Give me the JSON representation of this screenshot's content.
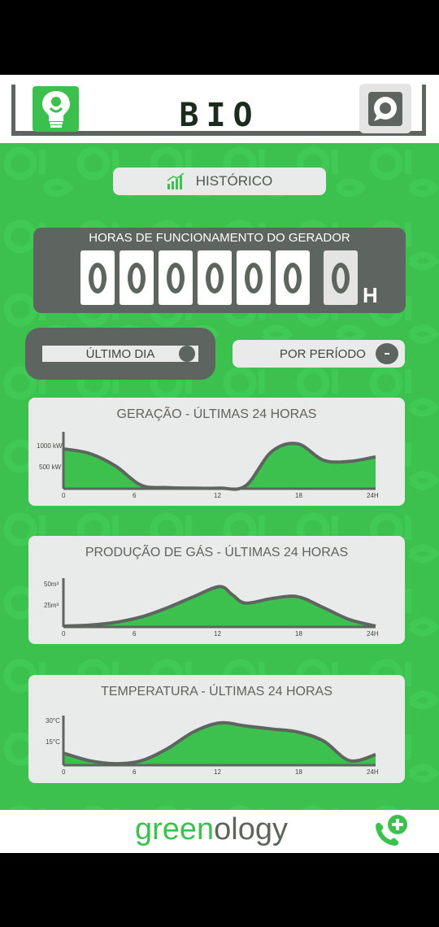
{
  "header": {
    "title": "BIO",
    "logo_icon": "lightbulb-icon",
    "chat_icon": "chat-bubble-icon"
  },
  "history_button": {
    "label": "HISTÓRICO",
    "icon": "bar-chart-growth-icon"
  },
  "counter": {
    "title": "HORAS DE FUNCIONAMENTO DO GERADOR",
    "digits": [
      "0",
      "0",
      "0",
      "0",
      "0",
      "0",
      "0"
    ],
    "unit": "H"
  },
  "filters": {
    "last_day_label": "ÚLTIMO DIA",
    "period_label": "POR PERÍODO",
    "period_dropdown_icon": "dropdown-dot-icon",
    "selected": "ÚLTIMO DIA"
  },
  "charts": {
    "generation": {
      "title": "GERAÇÃO - ÚLTIMAS 24 HORAS",
      "y_ticks": [
        "1000 kW",
        "500 kW"
      ],
      "x_ticks": [
        "0",
        "6",
        "12",
        "18",
        "24H"
      ]
    },
    "gas": {
      "title": "PRODUÇÃO DE GÁS - ÚLTIMAS 24 HORAS",
      "y_ticks": [
        "50m³",
        "25m³"
      ],
      "x_ticks": [
        "0",
        "6",
        "12",
        "18",
        "24H"
      ]
    },
    "temperature": {
      "title": "TEMPERATURA - ÚLTIMAS 24 HORAS",
      "y_ticks": [
        "30°C",
        "15°C"
      ],
      "x_ticks": [
        "0",
        "6",
        "12",
        "18",
        "24H"
      ]
    }
  },
  "chart_data": [
    {
      "type": "area",
      "title": "GERAÇÃO - ÚLTIMAS 24 HORAS",
      "x": [
        0,
        2,
        4,
        6,
        8,
        10,
        12,
        14,
        16,
        18,
        20,
        22,
        24
      ],
      "values": [
        700,
        620,
        400,
        60,
        20,
        10,
        10,
        50,
        650,
        790,
        500,
        480,
        560
      ],
      "ylabel": "kW",
      "ylim": [
        0,
        1000
      ],
      "xlim": [
        0,
        24
      ],
      "grid": false
    },
    {
      "type": "area",
      "title": "PRODUÇÃO DE GÁS - ÚLTIMAS 24 HORAS",
      "x": [
        0,
        2,
        4,
        6,
        8,
        10,
        12,
        13,
        14,
        16,
        18,
        20,
        22,
        24
      ],
      "values": [
        1,
        2,
        5,
        11,
        21,
        33,
        44,
        35,
        26,
        31,
        33,
        21,
        8,
        1
      ],
      "ylabel": "m³",
      "ylim": [
        0,
        55
      ],
      "xlim": [
        0,
        24
      ],
      "grid": false
    },
    {
      "type": "area",
      "title": "TEMPERATURA - ÚLTIMAS 24 HORAS",
      "x": [
        0,
        2,
        4,
        6,
        8,
        10,
        12,
        14,
        16,
        18,
        20,
        22,
        24
      ],
      "values": [
        8,
        3,
        1,
        3,
        11,
        22,
        28,
        26,
        24,
        22,
        16,
        3,
        7
      ],
      "ylabel": "°C",
      "ylim": [
        0,
        35
      ],
      "xlim": [
        0,
        24
      ],
      "grid": false
    }
  ],
  "footer": {
    "brand_green": "green",
    "brand_dark": "ology",
    "phone_icon": "phone-add-icon"
  },
  "colors": {
    "accent_green": "#3cc14f",
    "dark_gray": "#5e645f",
    "light_gray": "#e9ebea"
  }
}
